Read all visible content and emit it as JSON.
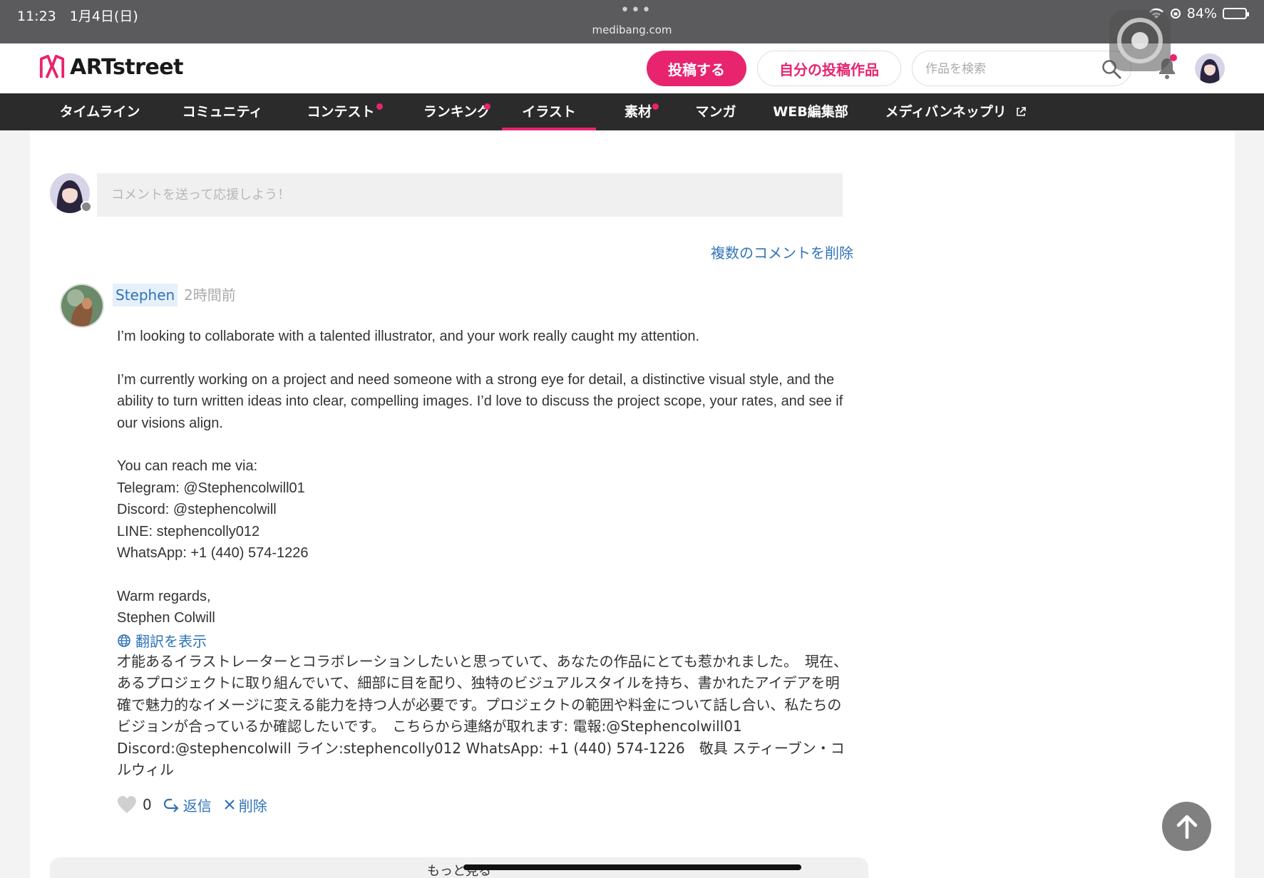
{
  "status": {
    "time": "11:23　1月4日(日)",
    "url": "medibang.com",
    "battery": "84%"
  },
  "header": {
    "logo": "ARTstreet",
    "post_button": "投稿する",
    "my_works_button": "自分の投稿作品",
    "search_placeholder": "作品を検索"
  },
  "nav": {
    "items": [
      {
        "label": "タイムライン"
      },
      {
        "label": "コミュニティ"
      },
      {
        "label": "コンテスト"
      },
      {
        "label": "ランキング"
      },
      {
        "label": "イラスト"
      },
      {
        "label": "素材"
      },
      {
        "label": "マンガ"
      },
      {
        "label": "WEB編集部"
      },
      {
        "label": "メディバンネップリ"
      }
    ]
  },
  "comment_form": {
    "placeholder": "コメントを送って応援しよう！",
    "bulk_delete": "複数のコメントを削除"
  },
  "comment": {
    "user": "Stephen",
    "time": "2時間前",
    "body": "I’m looking to collaborate with a talented illustrator, and your work really caught my attention.\n\nI’m currently working on a project and need someone with a strong eye for detail, a distinctive visual style, and the ability to turn written ideas into clear, compelling images. I’d love to discuss the project scope, your rates, and see if our visions align.\n\nYou can reach me via:\nTelegram: @Stephencolwill01\nDiscord: @stephencolwill\nLINE: stephencolly012\nWhatsApp: +1 (440) 574-1226\n\nWarm regards,\nStephen Colwill",
    "translate_link": "翻訳を表示",
    "translation": "才能あるイラストレーターとコラボレーションしたいと思っていて、あなたの作品にとても惹かれました。　現在、あるプロジェクトに取り組んでいて、細部に目を配り、独特のビジュアルスタイルを持ち、書かれたアイデアを明確で魅力的なイメージに変える能力を持つ人が必要です。プロジェクトの範囲や料金について話し合い、私たちのビジョンが合っているか確認したいです。　こちらから連絡が取れます: 電報:@Stephencolwill01 Discord:@stephencolwill ライン:stephencolly012 WhatsApp: +1 (440) 574-1226　敬具 スティーブン・コルウィル",
    "like_count": "0",
    "reply": "返信",
    "delete": "削除"
  },
  "more_link": "もっと見る",
  "colors": {
    "accent": "#e8246f",
    "link": "#2f73b8",
    "nav_bg": "#2b2b2b"
  }
}
